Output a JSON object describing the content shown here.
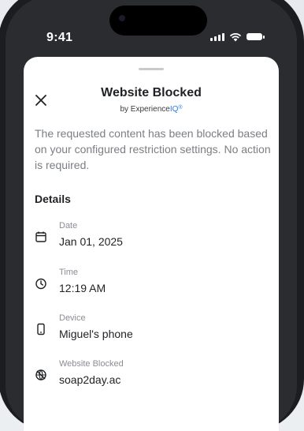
{
  "status_bar": {
    "time": "9:41"
  },
  "modal": {
    "title": "Website Blocked",
    "byline_prefix": "by ",
    "brand_name": "Experience",
    "brand_suffix": "IQ",
    "brand_mark": "®",
    "description": "The requested content has been blocked based on your configured restriction settings. No action is required.",
    "details_heading": "Details",
    "details": [
      {
        "label": "Date",
        "value": "Jan 01, 2025",
        "icon": "calendar-icon"
      },
      {
        "label": "Time",
        "value": "12:19 AM",
        "icon": "clock-icon"
      },
      {
        "label": "Device",
        "value": "Miguel's phone",
        "icon": "phone-icon"
      },
      {
        "label": "Website Blocked",
        "value": "soap2day.ac",
        "icon": "blocked-website-icon"
      }
    ]
  },
  "colors": {
    "accent": "#2a7de1",
    "text": "#1f2124",
    "muted": "#7b7e83"
  }
}
